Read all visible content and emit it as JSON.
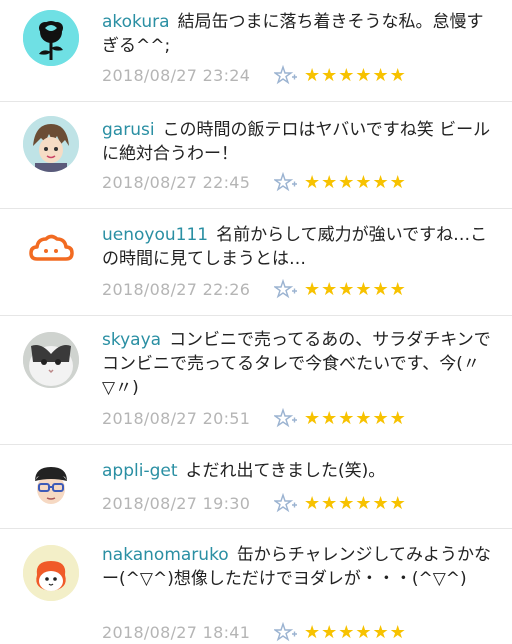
{
  "comments": [
    {
      "username": "akokura",
      "text": "結局缶つまに落ち着きそうな私。怠慢すぎる^^;",
      "date": "2018/08/27 23:24",
      "stars": "★★★★★★",
      "avatar": "black-rose-icon"
    },
    {
      "username": "garusi",
      "text": "この時間の飯テロはヤバいですね笑 ビールに絶対合うわー！",
      "date": "2018/08/27 22:45",
      "stars": "★★★★★★",
      "avatar": "cartoon-boy-avatar"
    },
    {
      "username": "uenoyou111",
      "text": "名前からして威力が強いですね…この時間に見てしまうとは…",
      "date": "2018/08/27 22:26",
      "stars": "★★★★★★",
      "avatar": "orange-cloud-icon"
    },
    {
      "username": "skyaya",
      "text": "コンビニで売ってるあの、サラダチキンでコンビニで売ってるタレで今食べたいです、今(〃▽〃)",
      "date": "2018/08/27 20:51",
      "stars": "★★★★★★",
      "avatar": "cat-photo-avatar"
    },
    {
      "username": "appli-get",
      "text": "よだれ出てきました(笑)。",
      "date": "2018/08/27 19:30",
      "stars": "★★★★★★",
      "avatar": "glasses-man-avatar"
    },
    {
      "username": "nakanomaruko",
      "text": "缶からチャレンジしてみようかなー(^▽^)想像しただけでヨダレが・・・(^▽^)",
      "date": "2018/08/27 18:41",
      "stars": "★★★★★★",
      "avatar": "maru-character-avatar"
    }
  ],
  "colors": {
    "username": "#2a8fa3",
    "date": "#b5b5b5",
    "star": "#f7c200",
    "star_add_icon": "#9bb3d1"
  }
}
